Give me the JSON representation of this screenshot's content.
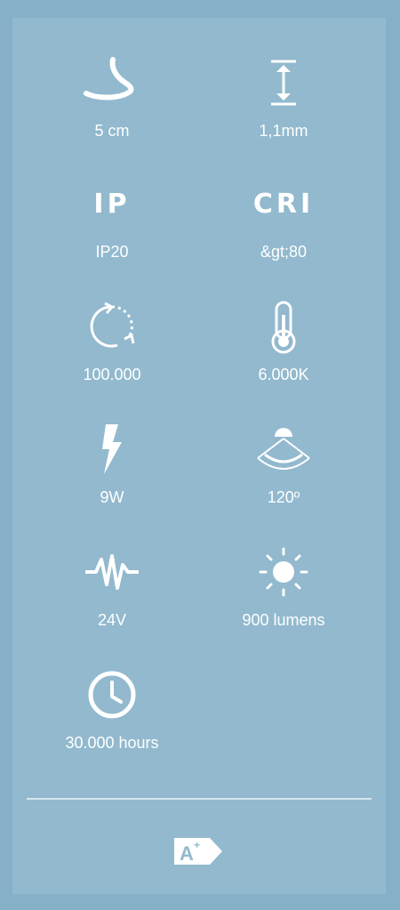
{
  "specs": [
    {
      "icon": "cut-length-icon",
      "value": "5 cm"
    },
    {
      "icon": "thickness-icon",
      "value": "1,1mm"
    },
    {
      "icon": "ip-icon",
      "badge": "IP",
      "value": "IP20"
    },
    {
      "icon": "cri-icon",
      "badge": "CRI",
      "value": "&gt;80"
    },
    {
      "icon": "lifecycle-icon",
      "value": "100.000"
    },
    {
      "icon": "thermometer-icon",
      "value": "6.000K"
    },
    {
      "icon": "lightning-icon",
      "value": "9W"
    },
    {
      "icon": "beam-angle-icon",
      "value": "120º"
    },
    {
      "icon": "voltage-wave-icon",
      "value": "24V"
    },
    {
      "icon": "sun-icon",
      "value": "900 lumens"
    },
    {
      "icon": "clock-icon",
      "value": "30.000 hours"
    }
  ],
  "energy_label": {
    "letter": "A",
    "sup": "+"
  },
  "colors": {
    "background": "#86b0c8",
    "panel": "#92b9ce",
    "icon": "#ffffff"
  }
}
